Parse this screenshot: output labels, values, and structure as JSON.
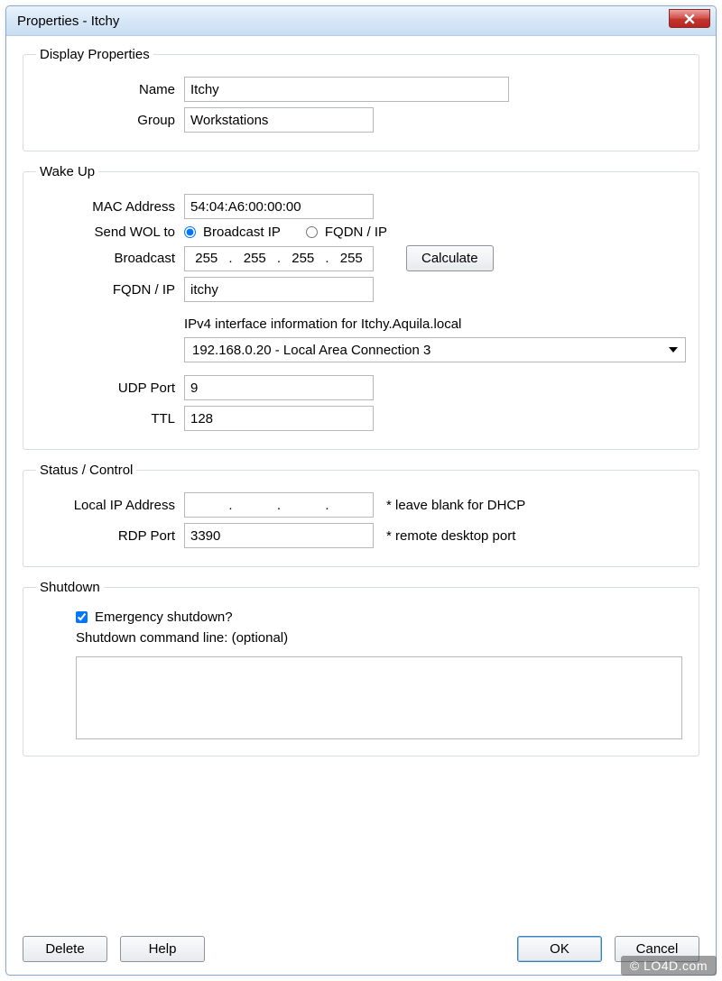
{
  "window": {
    "title": "Properties - Itchy"
  },
  "display": {
    "legend": "Display Properties",
    "name_label": "Name",
    "name_value": "Itchy",
    "group_label": "Group",
    "group_value": "Workstations"
  },
  "wake": {
    "legend": "Wake Up",
    "mac_label": "MAC Address",
    "mac_value": "54:04:A6:00:00:00",
    "send_label": "Send WOL to",
    "radio_broadcast": "Broadcast IP",
    "radio_fqdn": "FQDN / IP",
    "broadcast_label": "Broadcast",
    "broadcast_octets": [
      "255",
      "255",
      "255",
      "255"
    ],
    "calculate_label": "Calculate",
    "fqdn_label": "FQDN / IP",
    "fqdn_value": "itchy",
    "ipv4info": "IPv4 interface information for Itchy.Aquila.local",
    "ipv4combo": "192.168.0.20 - Local Area Connection 3",
    "udp_label": "UDP Port",
    "udp_value": "9",
    "ttl_label": "TTL",
    "ttl_value": "128"
  },
  "status": {
    "legend": "Status / Control",
    "localip_label": "Local IP Address",
    "localip_octets": [
      "",
      "",
      "",
      ""
    ],
    "localip_note": "* leave blank for DHCP",
    "rdp_label": "RDP Port",
    "rdp_value": "3390",
    "rdp_note": "* remote desktop port"
  },
  "shutdown": {
    "legend": "Shutdown",
    "emergency_label": "Emergency shutdown?",
    "emergency_checked": true,
    "cmd_label": "Shutdown command line: (optional)",
    "cmd_value": ""
  },
  "footer": {
    "delete": "Delete",
    "help": "Help",
    "ok": "OK",
    "cancel": "Cancel"
  },
  "watermark": "© LO4D.com"
}
